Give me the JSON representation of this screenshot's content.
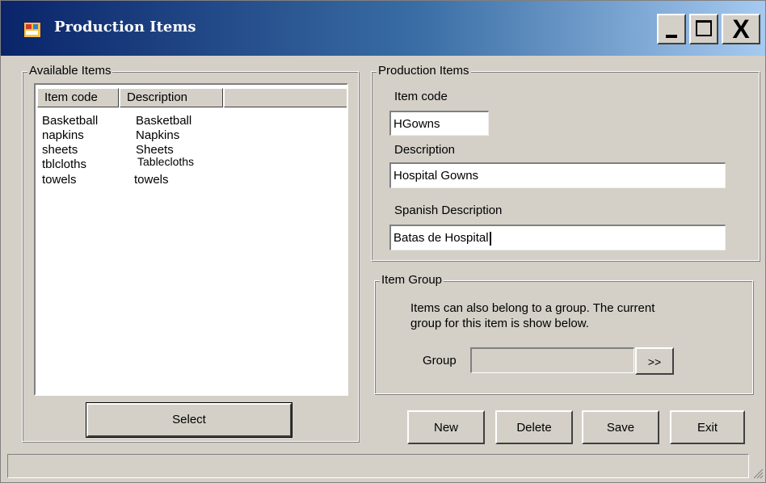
{
  "window": {
    "title": "Production Items",
    "close_glyph": "X"
  },
  "available_items": {
    "legend": "Available Items",
    "columns": [
      "Item code",
      "Description"
    ],
    "rows": [
      {
        "code": "Basketball",
        "description": "Basketball"
      },
      {
        "code": "napkins",
        "description": "Napkins"
      },
      {
        "code": "sheets",
        "description": "Sheets"
      },
      {
        "code": "tblcloths",
        "description": "Tablecloths"
      },
      {
        "code": "towels",
        "description": "towels"
      }
    ],
    "select_label": "Select"
  },
  "production_items": {
    "legend": "Production Items",
    "item_code_label": "Item code",
    "item_code_value": "HGowns",
    "description_label": "Description",
    "description_value": "Hospital Gowns",
    "spanish_label": "Spanish Description",
    "spanish_value": "Batas de Hospital"
  },
  "item_group": {
    "legend": "Item Group",
    "info_line1": "Items can also belong to a group. The current",
    "info_line2": "group for this item is show below.",
    "group_label": "Group",
    "group_value": "",
    "browse_label": ">>"
  },
  "actions": {
    "new": "New",
    "delete": "Delete",
    "save": "Save",
    "exit": "Exit"
  },
  "icons": {
    "app": "app-window-icon",
    "minimize": "minimize-icon",
    "maximize": "maximize-icon",
    "close": "close-icon",
    "grip": "resize-grip-icon"
  },
  "colors": {
    "title_gradient_start": "#0a246a",
    "title_gradient_end": "#a6caf0",
    "window_face": "#d4d0c8"
  }
}
